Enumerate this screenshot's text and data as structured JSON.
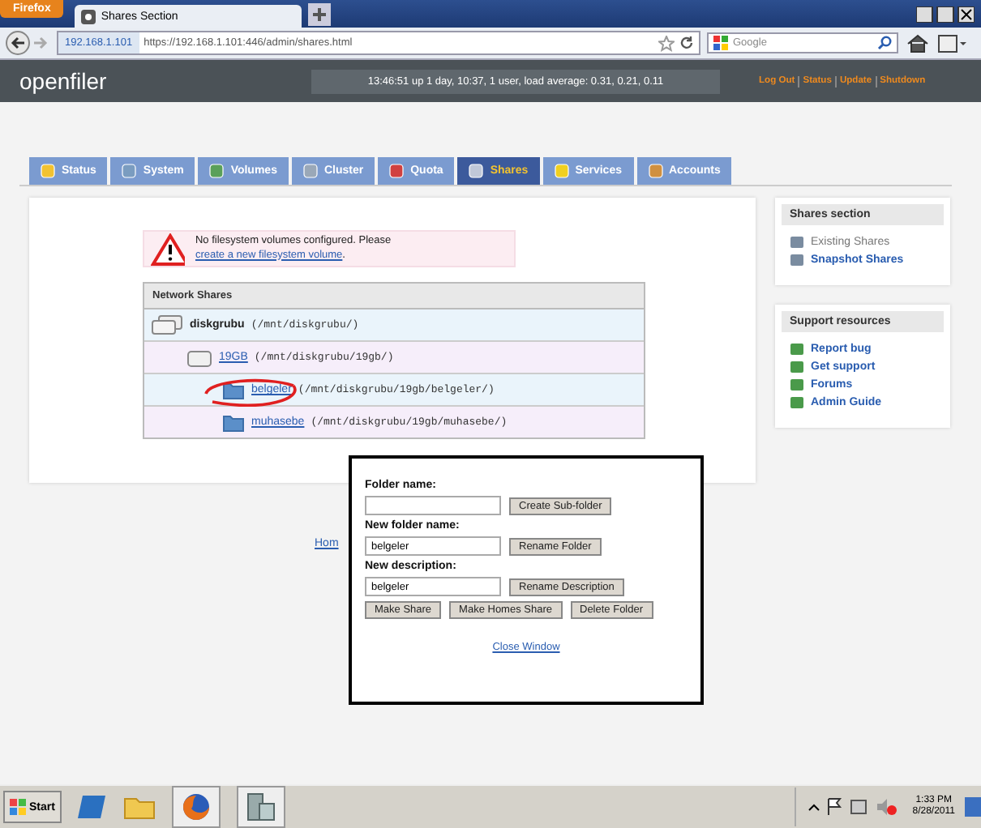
{
  "browser": {
    "menu_button": "Firefox",
    "tab_title": "Shares Section",
    "host": "192.168.1.101",
    "url": "https://192.168.1.101:446/admin/shares.html",
    "search_placeholder": "Google"
  },
  "header": {
    "logo": "openfiler",
    "uptime": "13:46:51 up 1 day, 10:37, 1 user, load average: 0.31, 0.21, 0.11",
    "links": [
      "Log Out",
      "Status",
      "Update",
      "Shutdown"
    ]
  },
  "nav_tabs": [
    {
      "label": "Status",
      "selected": false
    },
    {
      "label": "System",
      "selected": false
    },
    {
      "label": "Volumes",
      "selected": false
    },
    {
      "label": "Cluster",
      "selected": false
    },
    {
      "label": "Quota",
      "selected": false
    },
    {
      "label": "Shares",
      "selected": true
    },
    {
      "label": "Services",
      "selected": false
    },
    {
      "label": "Accounts",
      "selected": false
    }
  ],
  "warning": {
    "text": "No filesystem volumes configured. Please ",
    "link": "create a new filesystem volume",
    "after": "."
  },
  "shares_table": {
    "heading": "Network Shares",
    "rows": [
      {
        "kind": "group",
        "name": "diskgrubu",
        "path": "(/mnt/diskgrubu/)",
        "children": [
          {
            "kind": "volume",
            "name": "19GB",
            "path": "(/mnt/diskgrubu/19gb/)",
            "children": [
              {
                "kind": "folder",
                "name": "belgeler",
                "path": "(/mnt/diskgrubu/19gb/belgeler/)",
                "circled": true
              },
              {
                "kind": "folder",
                "name": "muhasebe",
                "path": "(/mnt/diskgrubu/19gb/muhasebe/)",
                "circled": false
              }
            ]
          }
        ]
      }
    ]
  },
  "sidebar": [
    {
      "title": "Shares section",
      "items": [
        {
          "label": "Existing Shares",
          "selected": true
        },
        {
          "label": "Snapshot Shares",
          "selected": false
        }
      ]
    },
    {
      "title": "Support resources",
      "items": [
        {
          "label": "Report bug",
          "selected": false
        },
        {
          "label": "Get support",
          "selected": false
        },
        {
          "label": "Forums",
          "selected": false
        },
        {
          "label": "Admin Guide",
          "selected": false
        }
      ]
    }
  ],
  "footer_link": "Hom",
  "popup": {
    "fields": [
      {
        "label": "Folder name:",
        "button": "Create Sub-folder"
      },
      {
        "label": "New folder name:",
        "value": "belgeler",
        "button": "Rename Folder"
      },
      {
        "label": "New description:",
        "value": "belgeler",
        "button": "Rename Description"
      }
    ],
    "buttons": [
      "Make Share",
      "Make Homes Share",
      "Delete Folder"
    ],
    "close": "Close Window"
  },
  "taskbar": {
    "start": "Start",
    "time": "1:33 PM",
    "date": "8/28/2011"
  }
}
